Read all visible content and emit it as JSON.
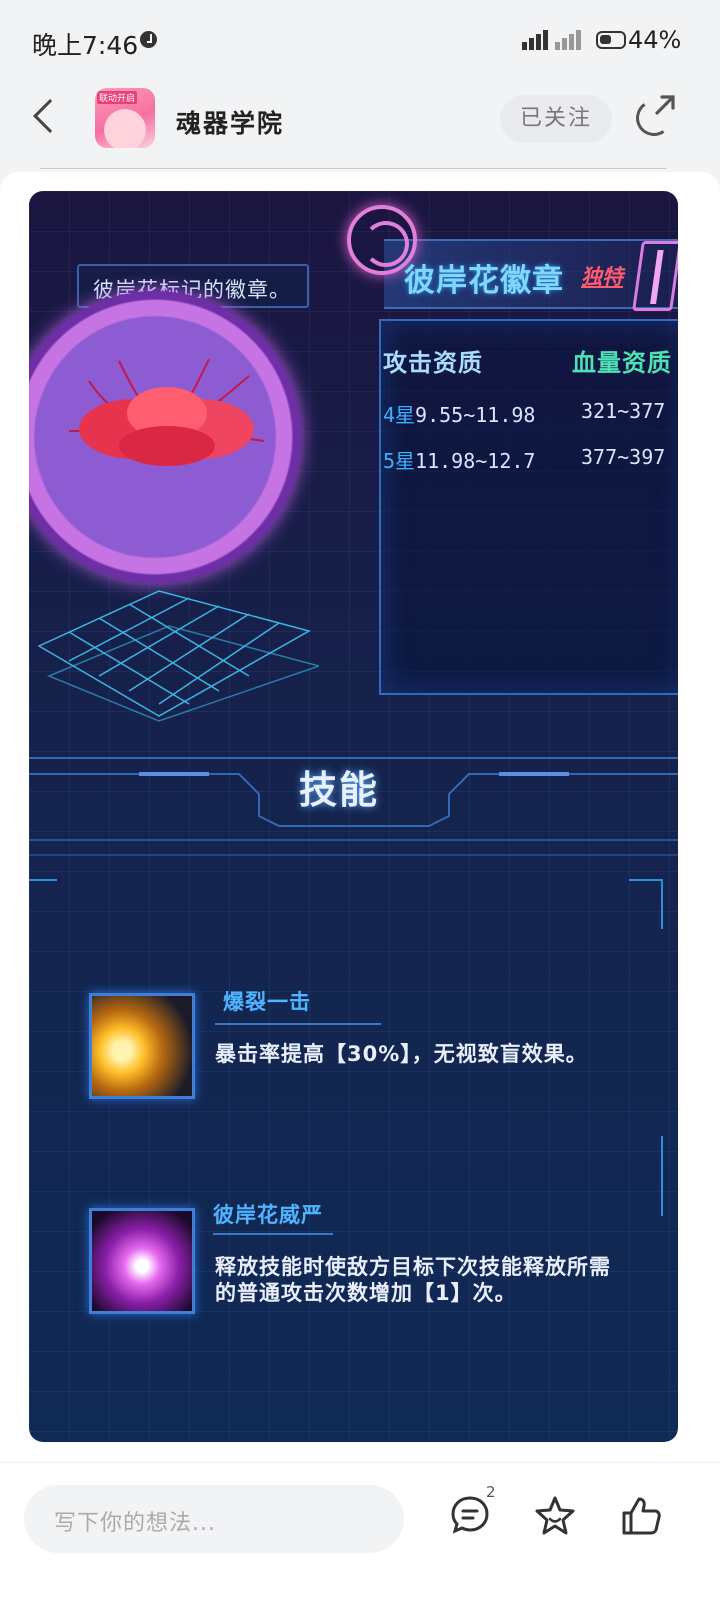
{
  "status_bar": {
    "time": "晚上7:46",
    "battery": "44%"
  },
  "header": {
    "app_name": "魂器学院",
    "app_avatar_tag": "联动开启",
    "follow_label": "已关注"
  },
  "game_image": {
    "badge_title": "彼岸花徽章",
    "unique_tag": "独特",
    "badge_description": "彼岸花标记的徽章。",
    "stats_headers": {
      "attack": "攻击资质",
      "hp": "血量资质"
    },
    "stats_rows": [
      {
        "star": "4星",
        "attack": "9.55~11.98",
        "hp": "321~377"
      },
      {
        "star": "5星",
        "attack": "11.98~12.7",
        "hp": "377~397"
      }
    ],
    "skills_title": "技能",
    "skills": [
      {
        "name": "爆裂一击",
        "description": "暴击率提高【30%】，无视致盲效果。"
      },
      {
        "name": "彼岸花威严",
        "description": "释放技能时使敌方目标下次技能释放所需的普通攻击次数增加【1】次。"
      }
    ]
  },
  "bottom_bar": {
    "comment_placeholder": "写下你的想法...",
    "comment_count": "2"
  },
  "colors": {
    "accent_blue": "#4fb4ff",
    "hp_green": "#4fe0b5",
    "unique_red": "#ff5a6e",
    "medal_purple": "#c673e4"
  }
}
